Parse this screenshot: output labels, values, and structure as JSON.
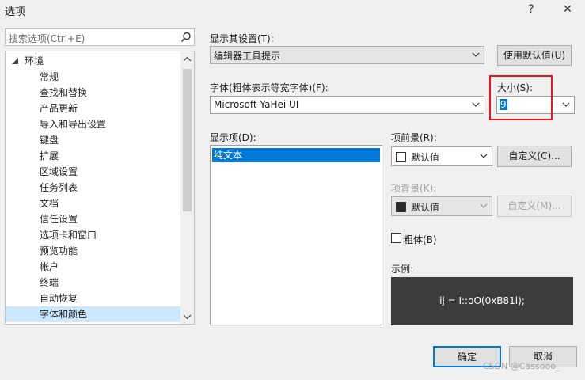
{
  "window": {
    "title": "选项",
    "help_glyph": "?",
    "close_glyph": "✕"
  },
  "search": {
    "placeholder": "搜索选项(Ctrl+E)"
  },
  "tree": {
    "root": "环境",
    "items": [
      "常规",
      "查找和替换",
      "产品更新",
      "导入和导出设置",
      "键盘",
      "扩展",
      "区域设置",
      "任务列表",
      "文档",
      "信任设置",
      "选项卡和窗口",
      "预览功能",
      "帐户",
      "终端",
      "自动恢复",
      "字体和颜色"
    ],
    "selected": "字体和颜色"
  },
  "settings": {
    "show_settings_label": "显示其设置(T):",
    "show_settings_value": "编辑器工具提示",
    "use_defaults_button": "使用默认值(U)",
    "font_label": "字体(粗体表示等宽字体)(F):",
    "font_value": "Microsoft YaHei UI",
    "size_label": "大小(S):",
    "size_value": "9",
    "display_items_label": "显示项(D):",
    "display_items": [
      "纯文本"
    ],
    "foreground_label": "项前景(R):",
    "foreground_value": "默认值",
    "foreground_custom_button": "自定义(C)...",
    "background_label": "项背景(K):",
    "background_value": "默认值",
    "background_custom_button": "自定义(M)...",
    "bold_label": "粗体(B)",
    "bold_checked": false,
    "sample_label": "示例:",
    "sample_text": "ij = I::oO(0xB81l);"
  },
  "footer": {
    "ok_button": "确定",
    "cancel_button": "取消",
    "watermark": "CSDN @Cassooo_"
  },
  "colors": {
    "highlight_border": "#e8161b",
    "selection": "#0078d7",
    "tree_selection": "#cce8ff",
    "sample_bg": "#3c3c3c"
  }
}
